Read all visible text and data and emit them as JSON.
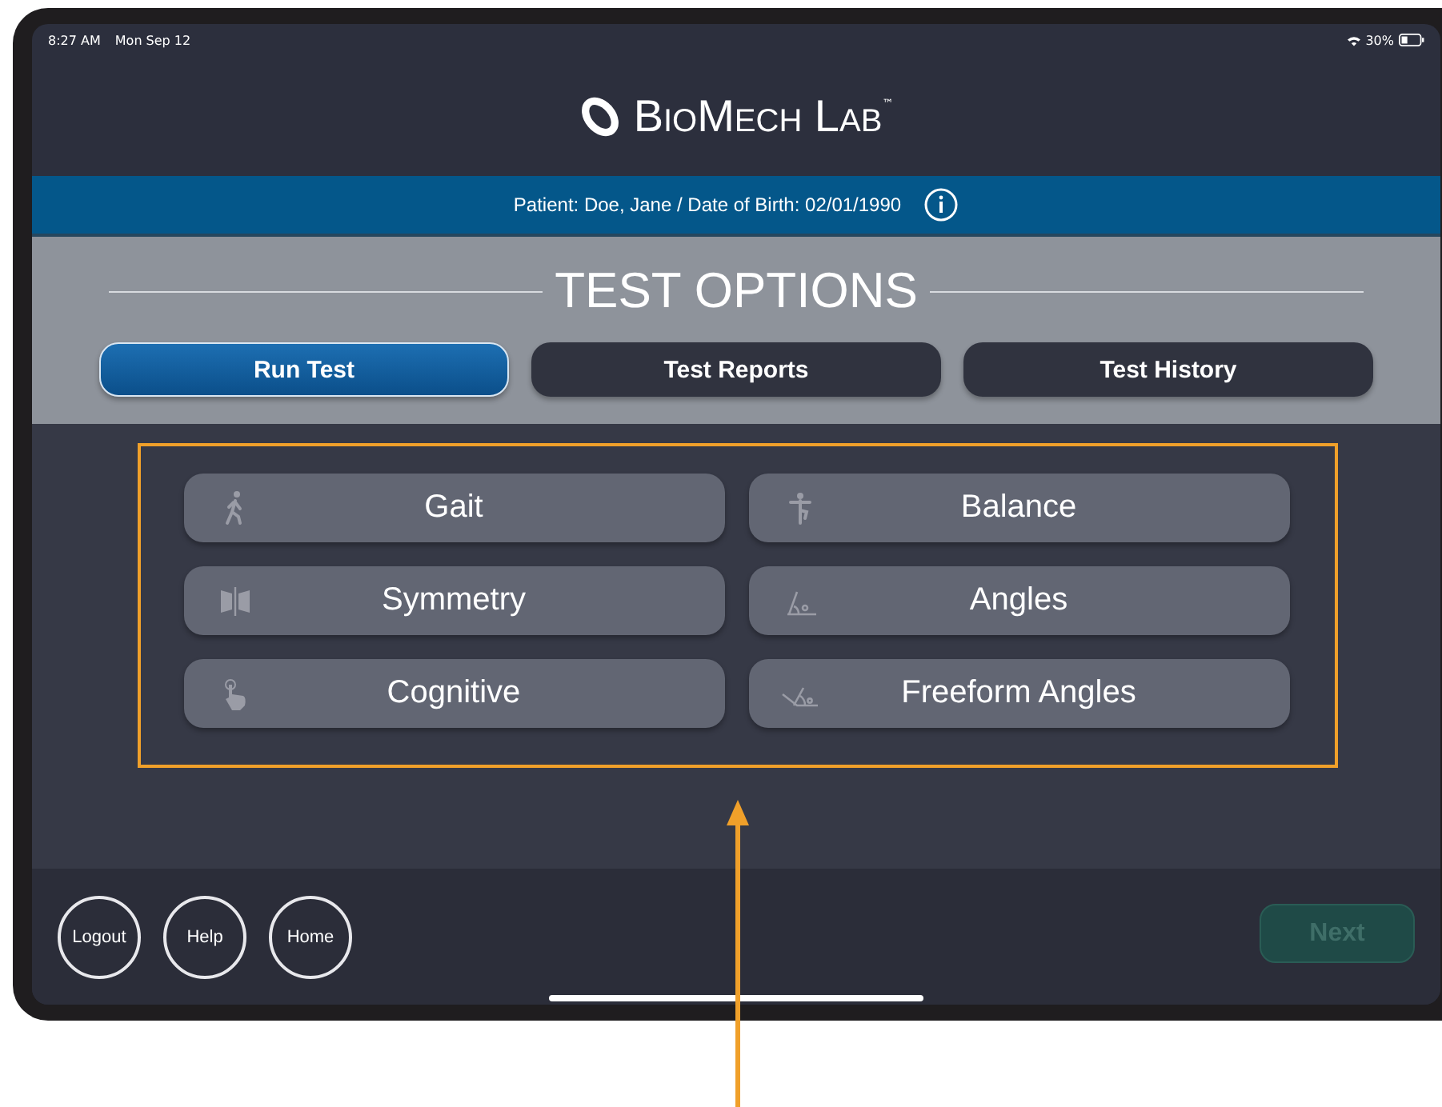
{
  "status_bar": {
    "time": "8:27 AM",
    "date": "Mon Sep 12",
    "battery": "30%"
  },
  "header": {
    "brand": "BioMech Lab",
    "trademark": "™"
  },
  "patient_bar": {
    "text": "Patient: Doe, Jane / Date of Birth: 02/01/1990"
  },
  "section_title": "TEST OPTIONS",
  "tabs": [
    {
      "label": "Run Test",
      "selected": true
    },
    {
      "label": "Test Reports",
      "selected": false
    },
    {
      "label": "Test History",
      "selected": false
    }
  ],
  "tests": [
    {
      "label": "Gait",
      "kind": "walk"
    },
    {
      "label": "Balance",
      "kind": "balance"
    },
    {
      "label": "Symmetry",
      "kind": "symmetry"
    },
    {
      "label": "Angles",
      "kind": "angle"
    },
    {
      "label": "Cognitive",
      "kind": "touch"
    },
    {
      "label": "Freeform Angles",
      "kind": "freeform"
    }
  ],
  "footer": {
    "buttons": [
      "Logout",
      "Help",
      "Home"
    ],
    "next": {
      "label": "Next",
      "disabled": true
    }
  }
}
